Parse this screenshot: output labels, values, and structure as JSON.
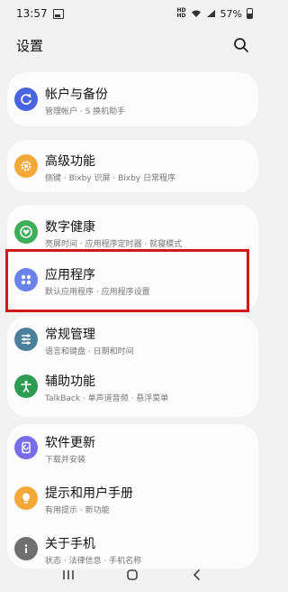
{
  "status": {
    "time": "13:57",
    "battery": "57%"
  },
  "header": {
    "title": "设置"
  },
  "items": [
    {
      "title": "帐户与备份",
      "subtitle": "管理帐户 · S 换机助手",
      "icon": "account-backup-icon",
      "color": "#4a63e0"
    },
    {
      "title": "高级功能",
      "subtitle": "侧键 · Bixby 识屏 · Bixby 日常程序",
      "icon": "gear-star-icon",
      "color": "#f3a93a"
    },
    {
      "title": "数字健康",
      "subtitle": "亮屏时间 · 应用程序定时器 · 就寝模式",
      "icon": "heart-circle-icon",
      "color": "#3fae5b"
    },
    {
      "title": "应用程序",
      "subtitle": "默认应用程序 · 应用程序设置",
      "icon": "apps-grid-icon",
      "color": "#6b82ea"
    },
    {
      "title": "常规管理",
      "subtitle": "语言和键盘 · 日期和时间",
      "icon": "sliders-icon",
      "color": "#4c7f9a"
    },
    {
      "title": "辅助功能",
      "subtitle": "TalkBack · 单声道音频 · 悬浮菜单",
      "icon": "accessibility-icon",
      "color": "#2d9b53"
    },
    {
      "title": "软件更新",
      "subtitle": "下载并安装",
      "icon": "update-icon",
      "color": "#7a6be8"
    },
    {
      "title": "提示和用户手册",
      "subtitle": "有用提示 · 新功能",
      "icon": "bulb-icon",
      "color": "#f3a93a"
    },
    {
      "title": "关于手机",
      "subtitle": "状态 · 法律信息 · 手机名称",
      "icon": "info-icon",
      "color": "#6f6f6f"
    }
  ],
  "nav": {
    "recent": "recent-apps",
    "home": "home",
    "back": "back"
  }
}
